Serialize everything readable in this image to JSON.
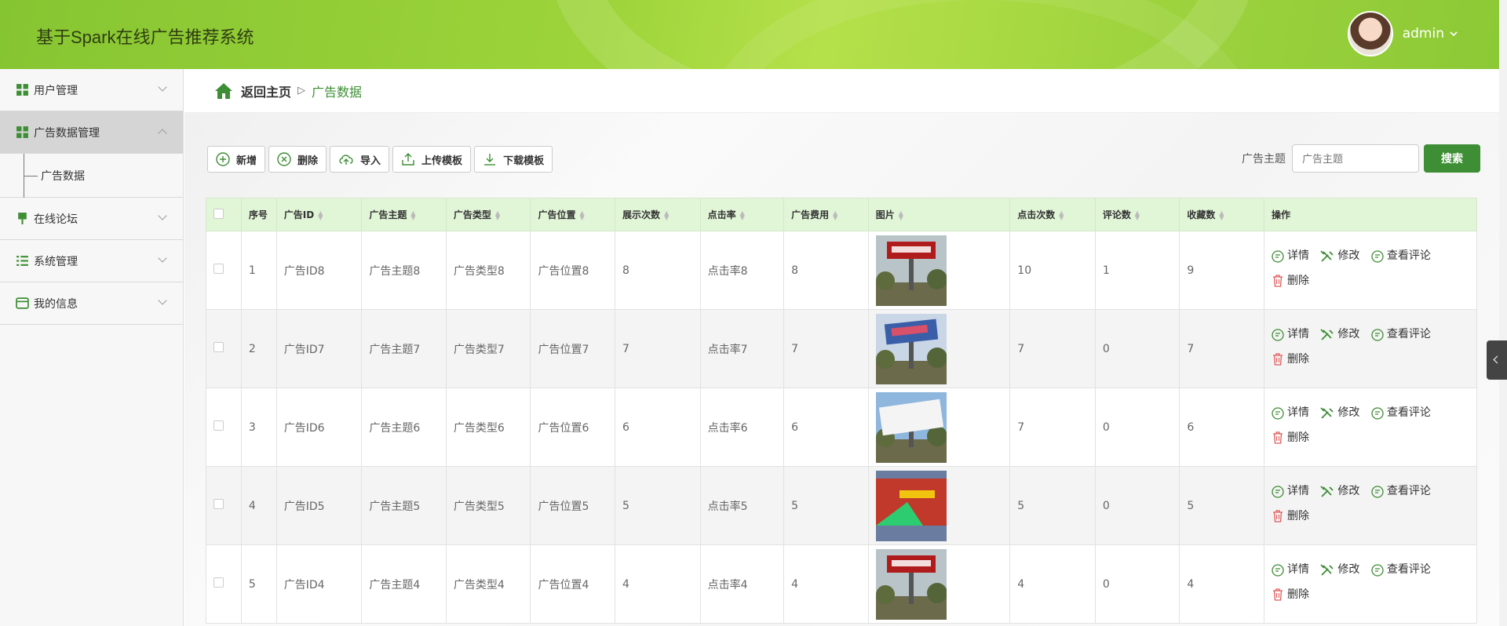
{
  "app": {
    "title": "基于Spark在线广告推荐系统",
    "username": "admin"
  },
  "colors": {
    "brand": "#9dd43a",
    "accent": "#3d8e34",
    "header_bg": "#e1f5d7"
  },
  "sidebar": {
    "items": [
      {
        "label": "用户管理",
        "icon": "grid-icon",
        "expanded": false
      },
      {
        "label": "广告数据管理",
        "icon": "grid-icon",
        "expanded": true
      },
      {
        "label": "广告数据",
        "icon": "",
        "sub": true
      },
      {
        "label": "在线论坛",
        "icon": "pin-icon",
        "expanded": false
      },
      {
        "label": "系统管理",
        "icon": "list-icon",
        "expanded": false
      },
      {
        "label": "我的信息",
        "icon": "card-icon",
        "expanded": false
      }
    ]
  },
  "breadcrumb": {
    "home": "返回主页",
    "separator": "▷",
    "current": "广告数据"
  },
  "toolbar": {
    "add": "新增",
    "delete": "删除",
    "import": "导入",
    "upload_template": "上传模板",
    "download_template": "下载模板"
  },
  "search": {
    "label": "广告主题",
    "placeholder": "广告主题",
    "button": "搜索"
  },
  "table": {
    "headers": [
      "序号",
      "广告ID",
      "广告主题",
      "广告类型",
      "广告位置",
      "展示次数",
      "点击率",
      "广告费用",
      "图片",
      "点击次数",
      "评论数",
      "收藏数",
      "操作"
    ],
    "rows": [
      {
        "no": "1",
        "id": "广告ID8",
        "topic": "广告主题8",
        "type": "广告类型8",
        "position": "广告位置8",
        "views": "8",
        "ctr": "点击率8",
        "cost": "8",
        "image": "billboard-red",
        "clicks": "10",
        "comments": "1",
        "favorites": "9"
      },
      {
        "no": "2",
        "id": "广告ID7",
        "topic": "广告主题7",
        "type": "广告类型7",
        "position": "广告位置7",
        "views": "7",
        "ctr": "点击率7",
        "cost": "7",
        "image": "billboard-blue",
        "clicks": "7",
        "comments": "0",
        "favorites": "7"
      },
      {
        "no": "3",
        "id": "广告ID6",
        "topic": "广告主题6",
        "type": "广告类型6",
        "position": "广告位置6",
        "views": "6",
        "ctr": "点击率6",
        "cost": "6",
        "image": "billboard-blank",
        "clicks": "7",
        "comments": "0",
        "favorites": "6"
      },
      {
        "no": "4",
        "id": "广告ID5",
        "topic": "广告主题5",
        "type": "广告类型5",
        "position": "广告位置5",
        "views": "5",
        "ctr": "点击率5",
        "cost": "5",
        "image": "billboard-colorful",
        "clicks": "5",
        "comments": "0",
        "favorites": "5"
      },
      {
        "no": "5",
        "id": "广告ID4",
        "topic": "广告主题4",
        "type": "广告类型4",
        "position": "广告位置4",
        "views": "4",
        "ctr": "点击率4",
        "cost": "4",
        "image": "billboard-red",
        "clicks": "4",
        "comments": "0",
        "favorites": "4"
      }
    ],
    "actions": {
      "detail": "详情",
      "edit": "修改",
      "view_comments": "查看评论",
      "delete": "删除"
    }
  }
}
